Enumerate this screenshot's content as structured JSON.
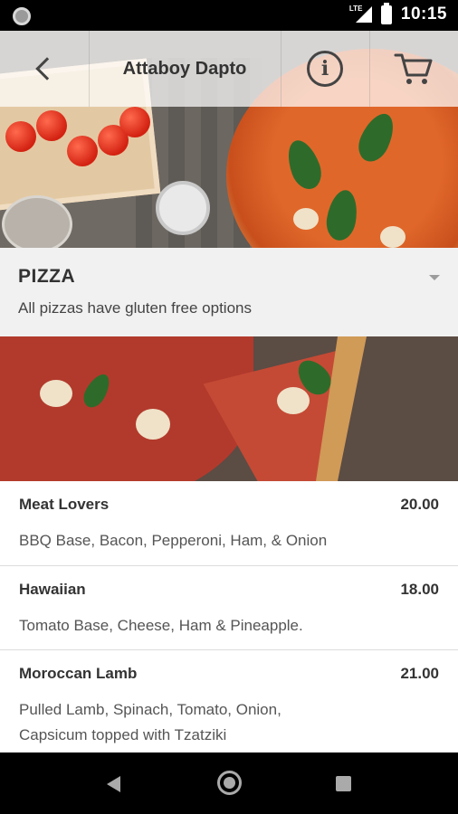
{
  "status_bar": {
    "time": "10:15",
    "network_label": "LTE",
    "icons": [
      "notification-dot-icon",
      "lte-signal-icon",
      "battery-icon"
    ]
  },
  "app_bar": {
    "title": "Attaboy Dapto",
    "back_icon": "chevron-left-icon",
    "info_icon": "info-icon",
    "info_glyph": "i",
    "cart_icon": "cart-icon"
  },
  "category": {
    "title": "PIZZA",
    "subtitle": "All pizzas have gluten free options",
    "toggle_icon": "caret-down-icon"
  },
  "menu_items": [
    {
      "name": "Meat Lovers",
      "price": "20.00",
      "description": "BBQ Base, Bacon, Pepperoni, Ham, & Onion"
    },
    {
      "name": "Hawaiian",
      "price": "18.00",
      "description": "Tomato Base, Cheese, Ham & Pineapple."
    },
    {
      "name": "Moroccan Lamb",
      "price": "21.00",
      "description": "Pulled Lamb, Spinach, Tomato, Onion, Capsicum topped with Tzatziki"
    }
  ],
  "nav_bar": {
    "icons": [
      "nav-back-icon",
      "nav-home-icon",
      "nav-recents-icon"
    ]
  },
  "colors": {
    "app_bar_bg": "#ffffff",
    "category_bg": "#f1f1f1",
    "text_primary": "#333333",
    "text_secondary": "#555555",
    "divider": "#dcdcdc"
  }
}
